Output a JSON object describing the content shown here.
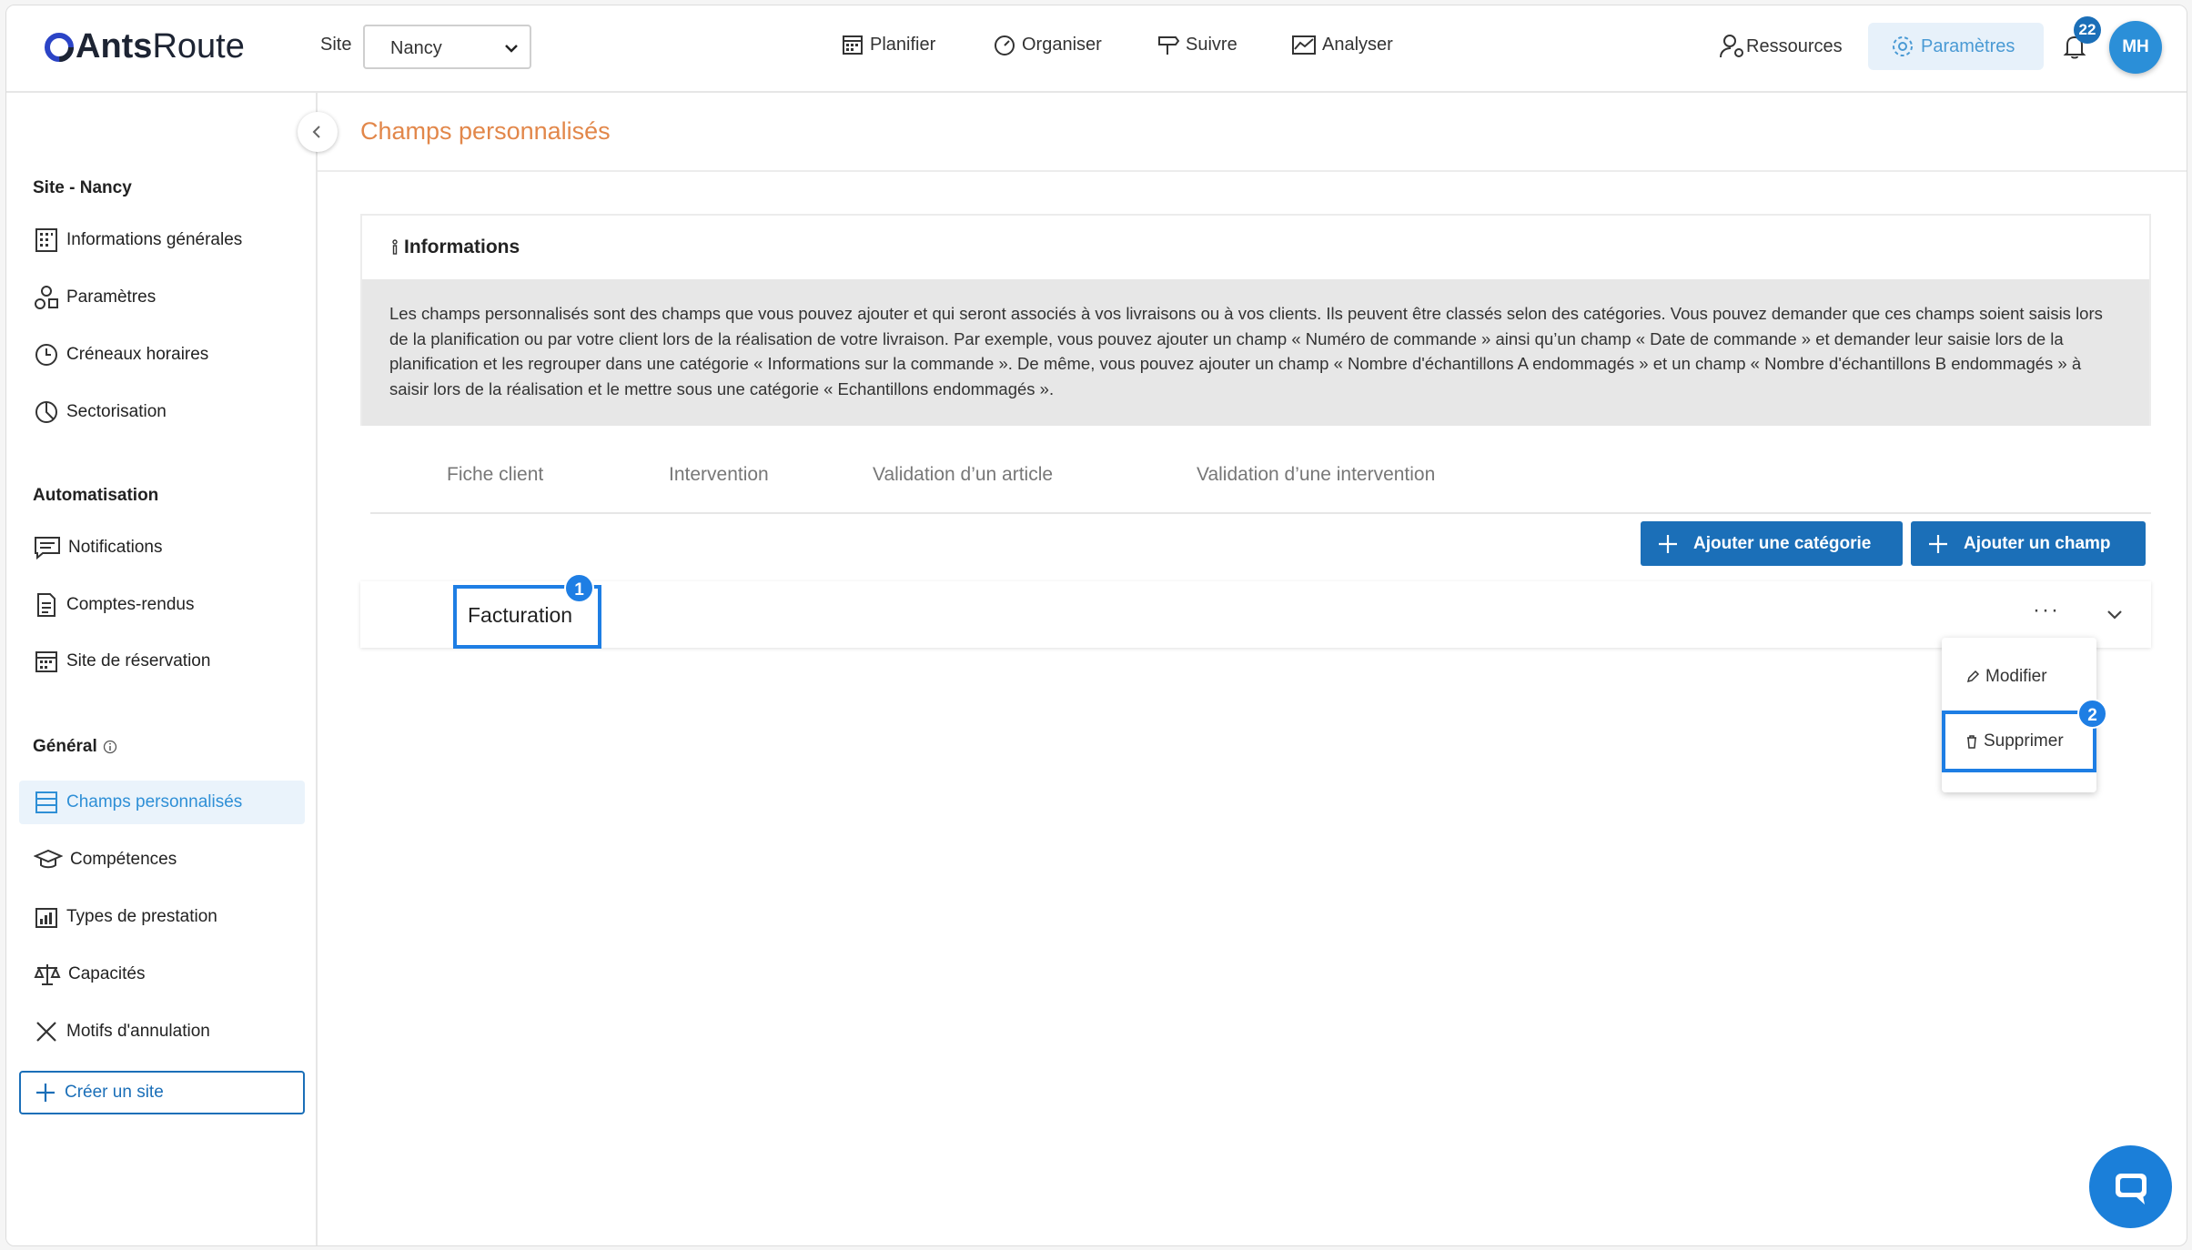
{
  "header": {
    "logo_bold": "Ants",
    "logo_light": "Route",
    "site_label": "Site",
    "site_value": "Nancy",
    "nav": [
      "Planifier",
      "Organiser",
      "Suivre",
      "Analyser"
    ],
    "resources": "Ressources",
    "settings": "Paramètres",
    "notifications_count": "22",
    "avatar": "MH"
  },
  "sidebar": {
    "section1": "Site - Nancy",
    "items1": [
      "Informations générales",
      "Paramètres",
      "Créneaux horaires",
      "Sectorisation"
    ],
    "section2": "Automatisation",
    "items2": [
      "Notifications",
      "Comptes-rendus",
      "Site de réservation"
    ],
    "section3": "Général",
    "items3": [
      "Champs personnalisés",
      "Compétences",
      "Types de prestation",
      "Capacités",
      "Motifs d'annulation"
    ],
    "create": "Créer un site"
  },
  "main": {
    "title": "Champs personnalisés",
    "info_title": "Informations",
    "info_text": "Les champs personnalisés sont des champs que vous pouvez ajouter et qui seront associés à vos livraisons ou à vos clients. Ils peuvent être classés selon des catégories. Vous pouvez demander que ces champs soient saisis lors de la planification ou par votre client lors de la réalisation de votre livraison. Par exemple, vous pouvez ajouter un champ « Numéro de commande » ainsi qu’un champ « Date de commande » et demander leur saisie lors de la planification et les regrouper dans une catégorie « Informations sur la commande ». De même, vous pouvez ajouter un champ « Nombre d'échantillons A endommagés » et un champ « Nombre d'échantillons B endommagés » à saisir lors de la réalisation et le mettre sous une catégorie « Echantillons endommagés ».",
    "tabs": [
      "Fiche client",
      "Intervention",
      "Validation d’un article",
      "Validation d’une intervention"
    ],
    "add_category": "Ajouter une catégorie",
    "add_field": "Ajouter un champ",
    "category": "Facturation",
    "menu": [
      "Modifier",
      "Supprimer"
    ],
    "markers": [
      "1",
      "2"
    ]
  },
  "colors": {
    "primary": "#1b6fb8",
    "accent_orange": "#e2874a",
    "highlight": "#1e7ee4"
  }
}
